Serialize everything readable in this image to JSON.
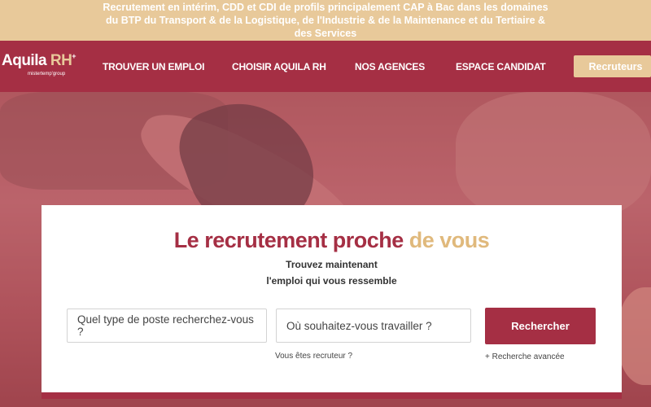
{
  "topbar": {
    "text": "Recrutement en intérim, CDD et CDI de profils principalement CAP à Bac dans les domaines du BTP du Transport & de la Logistique, de l'Industrie & de la Maintenance et du Tertiaire & des Services"
  },
  "logo": {
    "main": "Aquila",
    "rh": "RH",
    "sup": "+",
    "sub": "mistertemp'group"
  },
  "nav": {
    "items": [
      "TROUVER UN EMPLOI",
      "CHOISIR AQUILA RH",
      "NOS AGENCES",
      "ESPACE CANDIDAT"
    ],
    "cta": "Recruteurs"
  },
  "hero": {
    "headline_main": "Le recrutement proche ",
    "headline_accent": "de vous",
    "subline1": "Trouvez maintenant",
    "subline2": "l'emploi qui vous ressemble",
    "job_placeholder": "Quel type de poste recherchez-vous ?",
    "location_placeholder": "Où souhaitez-vous travailler ?",
    "search_label": "Rechercher",
    "recruiter_link": "Vous êtes recruteur ?",
    "advanced_link": "+ Recherche avancée"
  },
  "colors": {
    "brand": "#a52f44",
    "accent": "#e8c99a"
  }
}
